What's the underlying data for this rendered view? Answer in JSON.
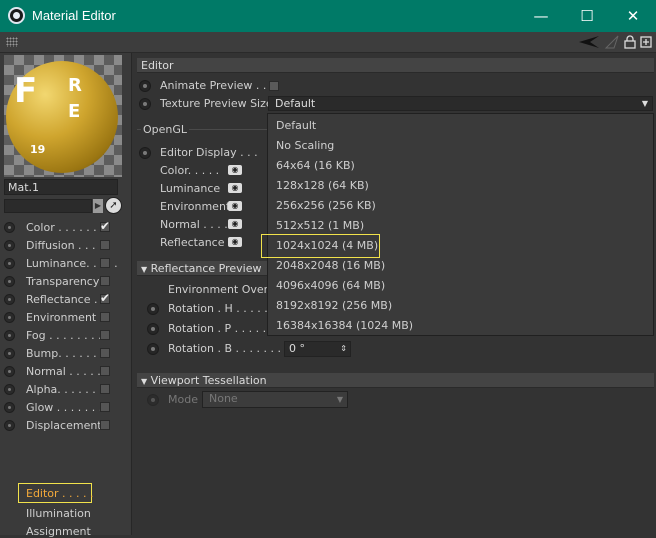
{
  "window": {
    "title": "Material Editor",
    "minimize": "—",
    "maximize": "☐",
    "close": "✕"
  },
  "material": {
    "name": "Mat.1",
    "preview_letters": {
      "f": "F",
      "r": "R",
      "e": "E",
      "num": "19"
    }
  },
  "channels": [
    {
      "label": "Color . . . . . . . .",
      "checked": true
    },
    {
      "label": "Diffusion . . . . .",
      "checked": false
    },
    {
      "label": "Luminance. . . . .",
      "checked": false
    },
    {
      "label": "Transparency",
      "checked": false
    },
    {
      "label": "Reflectance . .",
      "checked": true
    },
    {
      "label": "Environment",
      "checked": false
    },
    {
      "label": "Fog . . . . . . . . .",
      "checked": false
    },
    {
      "label": "Bump. . . . . . . .",
      "checked": false
    },
    {
      "label": "Normal . . . . . .",
      "checked": false
    },
    {
      "label": "Alpha. . . . . . . .",
      "checked": false
    },
    {
      "label": "Glow . . . . . . . .",
      "checked": false
    },
    {
      "label": "Displacement",
      "checked": false
    }
  ],
  "extra_items": {
    "editor": "Editor . . . . .",
    "illumination": "Illumination",
    "assignment": "Assignment"
  },
  "editor_panel": {
    "header": "Editor",
    "animate_preview": "Animate Preview . . .",
    "texture_preview_size": "Texture Preview Size",
    "texture_preview_value": "Default",
    "opengl_label": "OpenGL",
    "editor_display": "Editor Display . . .",
    "color": "Color. . . . .",
    "luminance": "Luminance",
    "environment": "Environment",
    "normal": "Normal . . . .",
    "reflectance": "Reflectance"
  },
  "reflectance_preview": {
    "header": "Reflectance Preview",
    "env_override": "Environment Overri",
    "rotation_h": "Rotation . H . . . . . . . .",
    "rotation_p": "Rotation . P . . . . . . . .",
    "rotation_b": "Rotation . B . . . . . . . .",
    "rotation_b_value": "0 °"
  },
  "viewport_tessellation": {
    "header": "Viewport Tessellation",
    "mode_label": "Mode",
    "mode_value": "None"
  },
  "dropdown_options": [
    "Default",
    "No Scaling",
    "64x64 (16 KB)",
    "128x128 (64 KB)",
    "256x256 (256 KB)",
    "512x512 (1 MB)",
    "1024x1024 (4 MB)",
    "2048x2048 (16 MB)",
    "4096x4096 (64 MB)",
    "8192x8192 (256 MB)",
    "16384x16384 (1024 MB)"
  ],
  "colors": {
    "titlebar": "#007a67",
    "highlight": "#f1e24b",
    "active_item": "#f2a93b"
  }
}
